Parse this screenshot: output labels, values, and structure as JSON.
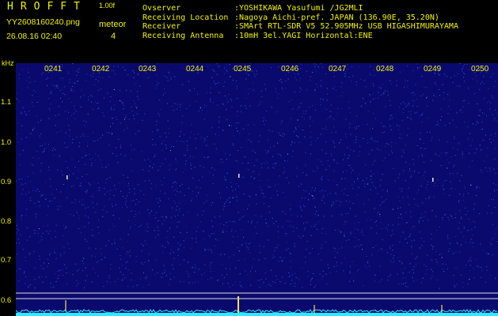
{
  "header": {
    "app_title": "HROFFT",
    "app_version": "1.00f",
    "filename": "YY2608160240.png",
    "datetime": "26.08.16 02:40",
    "meteor_label": "meteor",
    "meteor_count": "4"
  },
  "info": [
    {
      "key": "Ovserver",
      "value": ":YOSHIKAWA Yasufumi /JG2MLI"
    },
    {
      "key": "Receiving Location",
      "value": ":Nagoya Aichi-pref. JAPAN (136.90E, 35.20N)"
    },
    {
      "key": "Receiver",
      "value": ":SMArt RTL-SDR V5 52.905MHz USB HIGASHIMURAYAMA"
    },
    {
      "key": "Receiving Antenna",
      "value": ":10mH 3el.YAGI Horizontal:ENE"
    }
  ],
  "spectrogram": {
    "yaxis_unit": "kHz",
    "y_ticks": [
      "1.1",
      "1.0",
      "0.9",
      "0.8",
      "0.7",
      "0.6"
    ],
    "x_ticks": [
      "0241",
      "0242",
      "0243",
      "0244",
      "0245",
      "0246",
      "0247",
      "0248",
      "0249",
      "0250"
    ],
    "colors": {
      "background": "#0a0a6e",
      "noise": "#3c64ff",
      "label": "#f2f200",
      "trace": "#30e8ff"
    }
  }
}
